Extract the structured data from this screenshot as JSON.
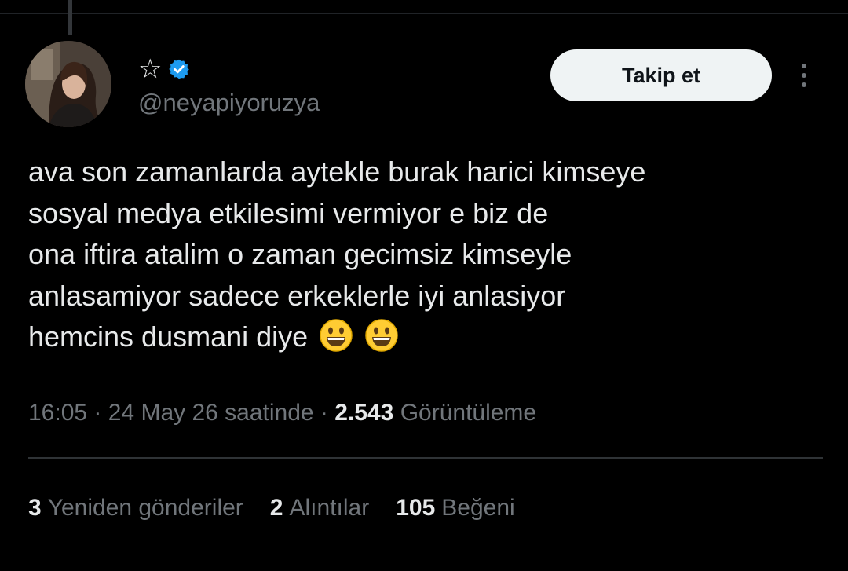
{
  "author": {
    "display_name": "☆",
    "handle": "@neyapiyoruzya",
    "verified": true,
    "verified_color": "#1d9bf0"
  },
  "follow_button": {
    "label": "Takip et"
  },
  "tweet": {
    "lines": [
      "ava son zamanlarda aytekle burak harici kimseye",
      "sosyal medya etkilesimi vermiyor e biz de",
      "ona iftira atalim o zaman gecimsiz kimseyle",
      "anlasamiyor sadece erkeklerle iyi anlasiyor",
      "hemcins dusmani diye"
    ],
    "emojis": [
      "grinning-face",
      "grinning-face"
    ]
  },
  "meta": {
    "time": "16:05",
    "sep1": " · ",
    "date": "24 May 26 saatinde",
    "sep2": " · ",
    "views_count": "2.543",
    "views_label": "Görüntüleme"
  },
  "stats": {
    "retweets": {
      "count": "3",
      "label": "Yeniden gönderiler"
    },
    "quotes": {
      "count": "2",
      "label": "Alıntılar"
    },
    "likes": {
      "count": "105",
      "label": "Beğeni"
    }
  },
  "colors": {
    "background": "#000000",
    "text_primary": "#e7e9ea",
    "text_secondary": "#71767b",
    "divider": "#2f3336",
    "button_bg": "#eff3f4"
  }
}
